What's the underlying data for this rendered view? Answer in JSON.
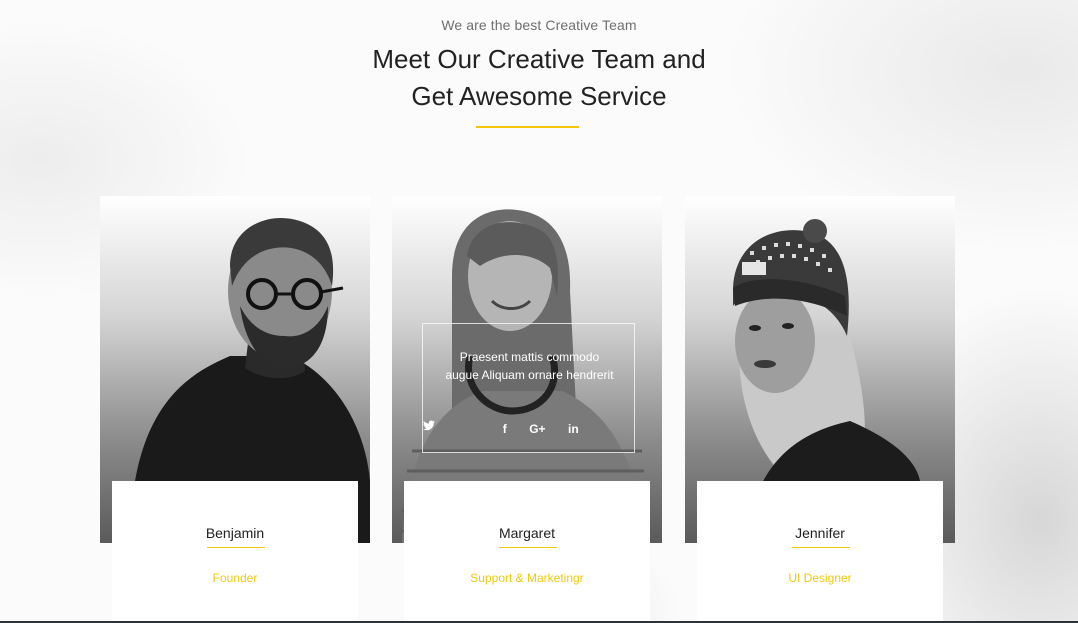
{
  "header": {
    "subtitle": "We are the best Creative Team",
    "title_line1": "Meet Our Creative Team and",
    "title_line2": "Get Awesome Service"
  },
  "colors": {
    "accent": "#f2c80f",
    "heading": "#222222",
    "subtitle": "#6f6f6f"
  },
  "team": [
    {
      "name": "Benjamin",
      "role": "Founder"
    },
    {
      "name": "Margaret",
      "role": "Support & Marketingr",
      "overlay_text": "Praesent mattis commodo augue Aliquam ornare hendrerit",
      "socials": [
        {
          "icon": "twitter-icon",
          "glyph": "🐦"
        },
        {
          "icon": "facebook-icon",
          "glyph": "f"
        },
        {
          "icon": "google-plus-icon",
          "glyph": "G+"
        },
        {
          "icon": "linkedin-icon",
          "glyph": "in"
        }
      ]
    },
    {
      "name": "Jennifer",
      "role": "UI Designer"
    }
  ]
}
